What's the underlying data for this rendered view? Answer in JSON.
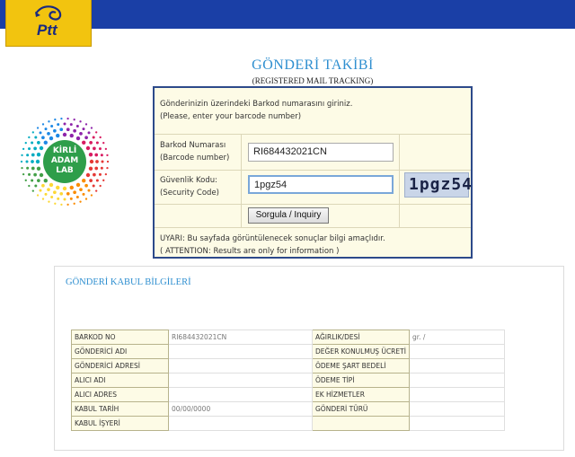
{
  "header": {
    "logo_text": "Ptt",
    "bar_color": "#1a3fa6",
    "logo_color": "#f2c40f"
  },
  "side_logo": {
    "line1": "KİRLİ",
    "line2": "ADAM",
    "line3": "LAB"
  },
  "page": {
    "title": "GÖNDERİ TAKİBİ",
    "subtitle": "(REGISTERED MAIL TRACKING)"
  },
  "form": {
    "intro_tr": "Gönderinizin üzerindeki Barkod numarasını giriniz.",
    "intro_en": "(Please, enter your barcode number)",
    "barcode_label_tr": "Barkod Numarası",
    "barcode_label_en": "(Barcode number)",
    "barcode_value": "RI684432021CN",
    "security_label_tr": "Güvenlik Kodu:",
    "security_label_en": "(Security Code)",
    "security_value": "1pgz54",
    "captcha_text": "1pgz54",
    "submit_label": "Sorgula / Inquiry",
    "warning_tr": "UYARI: Bu sayfada görüntülenecek sonuçlar bilgi amaçlıdır.",
    "warning_en": "( ATTENTION: Results are only for information )"
  },
  "acceptance": {
    "title": "GÖNDERİ KABUL BİLGİLERİ",
    "rows": [
      {
        "k1": "BARKOD NO",
        "v1": "RI684432021CN",
        "k2": "AĞIRLIK/DESİ",
        "v2": "gr. /"
      },
      {
        "k1": "GÖNDERİCİ ADI",
        "v1": "",
        "k2": "DEĞER KONULMUŞ ÜCRETİ",
        "v2": ""
      },
      {
        "k1": "GÖNDERİCİ ADRESİ",
        "v1": "",
        "k2": "ÖDEME ŞART BEDELİ",
        "v2": ""
      },
      {
        "k1": "ALICI ADI",
        "v1": "",
        "k2": "ÖDEME TİPİ",
        "v2": ""
      },
      {
        "k1": "ALICI ADRES",
        "v1": "",
        "k2": "EK HİZMETLER",
        "v2": ""
      },
      {
        "k1": "KABUL TARİH",
        "v1": "00/00/0000",
        "k2": "GÖNDERİ TÜRÜ",
        "v2": ""
      },
      {
        "k1": "KABUL İŞYERİ",
        "v1": "",
        "k2": "",
        "v2": ""
      }
    ]
  }
}
